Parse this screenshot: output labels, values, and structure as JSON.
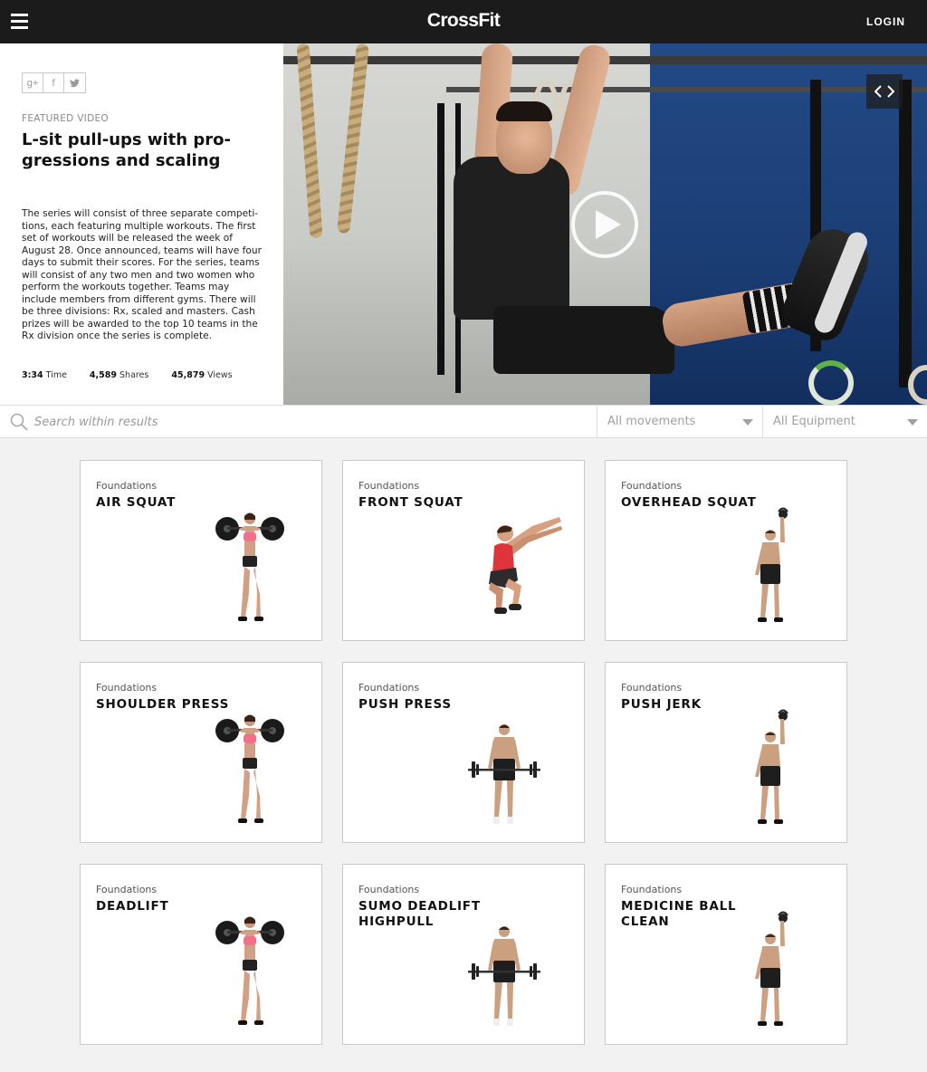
{
  "header": {
    "logo": "CrossFit",
    "login_label": "LOGIN"
  },
  "featured": {
    "share": [
      "g+",
      "f",
      "t"
    ],
    "kicker": "FEATURED VIDEO",
    "title": "L-sit pull-ups with pro-gressions and scaling",
    "body": "The series will consist of three separate competi-tions, each featuring multiple workouts. The first set of workouts will be released the week of August 28. Once announced, teams will have four days to submit their scores. For the series, teams will consist of any two men and two women who perform the workouts together. Teams may include members from different gyms. There will be three divisions: Rx, scaled and masters. Cash prizes will be awarded to the top 10 teams in the Rx division once the series is complete.",
    "stats": {
      "time_value": "3:34",
      "time_label": "Time",
      "shares_value": "4,589",
      "shares_label": "Shares",
      "views_value": "45,879",
      "views_label": "Views"
    }
  },
  "filters": {
    "search_placeholder": "Search within results",
    "movements": "All movements",
    "equipment": "All Equipment"
  },
  "cards": [
    {
      "category": "Foundations",
      "name": "AIR SQUAT",
      "figure": "woman-barbell"
    },
    {
      "category": "Foundations",
      "name": "FRONT SQUAT",
      "figure": "man-squat"
    },
    {
      "category": "Foundations",
      "name": "OVERHEAD SQUAT",
      "figure": "man-kettlebell"
    },
    {
      "category": "Foundations",
      "name": "SHOULDER PRESS",
      "figure": "woman-barbell"
    },
    {
      "category": "Foundations",
      "name": "PUSH PRESS",
      "figure": "man-barbell"
    },
    {
      "category": "Foundations",
      "name": "PUSH JERK",
      "figure": "man-kettlebell"
    },
    {
      "category": "Foundations",
      "name": "DEADLIFT",
      "figure": "woman-barbell"
    },
    {
      "category": "Foundations",
      "name": "SUMO DEADLIFT HIGHPULL",
      "figure": "man-barbell"
    },
    {
      "category": "Foundations",
      "name": "MEDICINE BALL CLEAN",
      "figure": "man-kettlebell"
    }
  ],
  "colors": {
    "topbar": "#1b1b1b",
    "page_bg": "#f2f2f2",
    "hero_blue": "#1a3d74"
  }
}
